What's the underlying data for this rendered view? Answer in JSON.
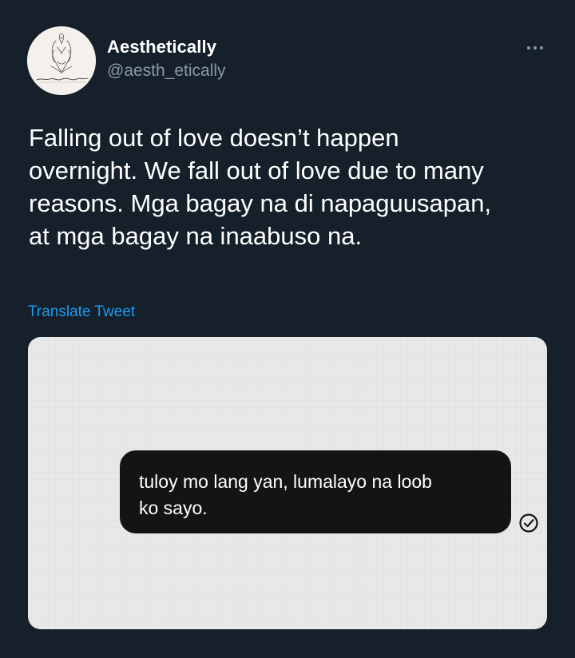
{
  "author": {
    "display_name": "Aesthetically",
    "handle": "@aesth_etically",
    "avatar_signature": "Aesthetically"
  },
  "tweet": {
    "lines": [
      "Falling out of love doesn’t happen",
      "overnight. We fall out of love due to many",
      "reasons. Mga bagay na di napaguusapan,",
      "at mga bagay na inaabuso na."
    ]
  },
  "translate_label": "Translate Tweet",
  "media": {
    "message_lines": [
      "tuloy mo lang yan, lumalayo na loob",
      "ko sayo."
    ],
    "status_icon": "check-circle-icon"
  },
  "icons": {
    "more": "more-options-icon"
  },
  "colors": {
    "background": "#15202b",
    "secondary_text": "#8b98a5",
    "link": "#1d9bf0",
    "bubble": "#141414",
    "media_bg": "#ebebeb"
  }
}
